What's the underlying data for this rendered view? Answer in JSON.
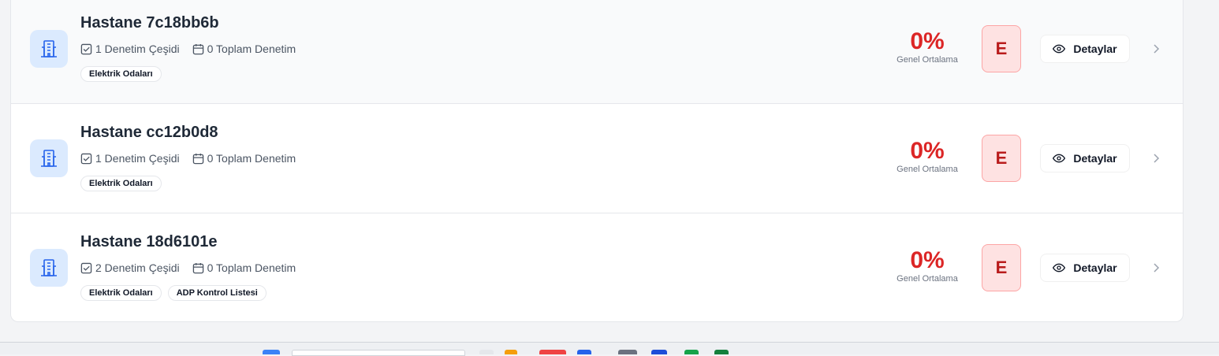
{
  "items": [
    {
      "title": "Hastane 7c18bb6b",
      "audit_types": "1 Denetim Çeşidi",
      "total_audits": "0 Toplam Denetim",
      "tags": [
        "Elektrik Odaları"
      ],
      "score": "0%",
      "score_label": "Genel Ortalama",
      "grade": "E",
      "details_label": "Detaylar"
    },
    {
      "title": "Hastane cc12b0d8",
      "audit_types": "1 Denetim Çeşidi",
      "total_audits": "0 Toplam Denetim",
      "tags": [
        "Elektrik Odaları"
      ],
      "score": "0%",
      "score_label": "Genel Ortalama",
      "grade": "E",
      "details_label": "Detaylar"
    },
    {
      "title": "Hastane 18d6101e",
      "audit_types": "2 Denetim Çeşidi",
      "total_audits": "0 Toplam Denetim",
      "tags": [
        "Elektrik Odaları",
        "ADP Kontrol Listesi"
      ],
      "score": "0%",
      "score_label": "Genel Ortalama",
      "grade": "E",
      "details_label": "Detaylar"
    }
  ],
  "colors": {
    "score": "#dc2626",
    "grade_bg": "#fee2e2",
    "grade_text": "#b91c1c",
    "icon_bg": "#dbeafe",
    "icon_fg": "#2563eb"
  }
}
